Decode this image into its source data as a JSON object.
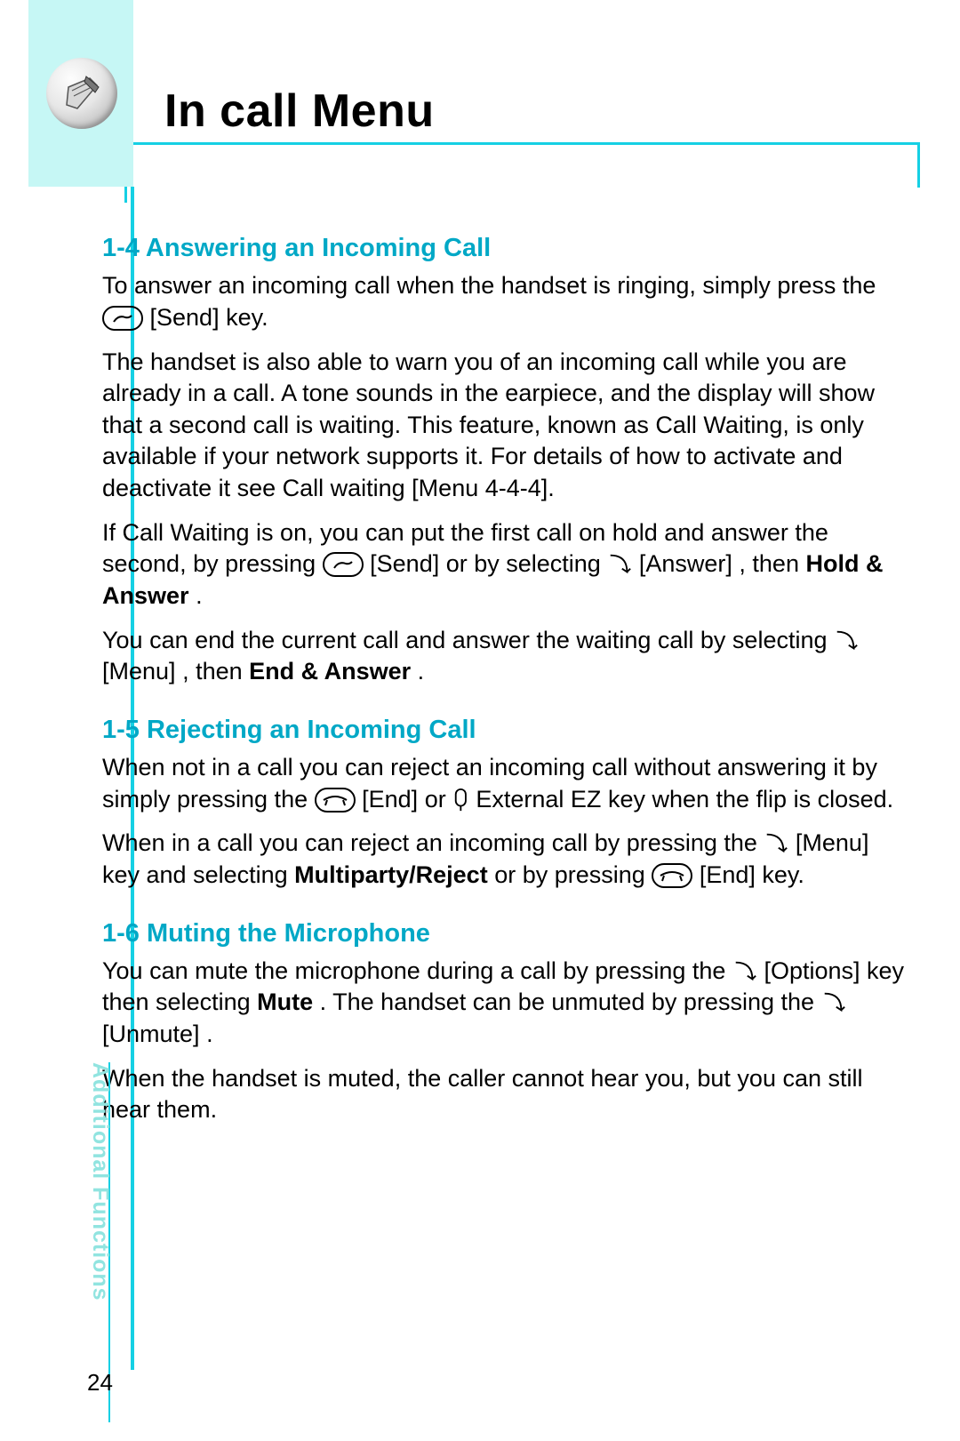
{
  "page": {
    "title": "In call Menu",
    "number": "24",
    "side_label": "Additional Functions"
  },
  "key_labels": {
    "send": "[Send]",
    "answer": "[Answer]",
    "menu": "[Menu]",
    "end": "[End]",
    "external_ez": "External EZ",
    "options": "[Options]",
    "unmute": "[Unmute]"
  },
  "sections": {
    "s14": {
      "heading": "1-4  Answering an Incoming Call",
      "p1a": "To answer an incoming call when the handset is ringing, simply press the ",
      "p1b": " key.",
      "p2": "The handset is also able to warn you of an incoming call while you are already in a call. A tone sounds in the earpiece, and the display will show that a second call is waiting. This feature, known as Call Waiting, is only available if your network supports it. For details of how to activate and deactivate it see Call waiting [Menu 4-4-4].",
      "p3a": "If Call Waiting is on, you can put the first call on hold and answer the second, by pressing ",
      "p3b": " or by selecting ",
      "p3c": ", then ",
      "p3bold": "Hold & Answer",
      "p3d": ".",
      "p4a": "You can end the current call and answer the waiting call by selecting ",
      "p4b": ", then ",
      "p4bold": "End & Answer",
      "p4c": "."
    },
    "s15": {
      "heading": "1-5  Rejecting an Incoming Call",
      "p1a": "When not in a call you can reject an incoming call without answering it by simply pressing the ",
      "p1b": " or ",
      "p1c": " key when the flip is closed.",
      "p2a": "When in a call you can reject an incoming call by pressing the ",
      "p2b": " key and selecting ",
      "p2bold": "Multiparty/Reject",
      "p2c": " or by pressing ",
      "p2d": " key."
    },
    "s16": {
      "heading": "1-6  Muting the Microphone",
      "p1a": "You can mute the microphone during a call by pressing the ",
      "p1b": " key then selecting ",
      "p1bold": "Mute",
      "p1c": ". The handset can be unmuted by pressing the ",
      "p1d": ".",
      "p2": "When the handset is muted, the caller cannot hear you, but you can still hear them."
    }
  }
}
